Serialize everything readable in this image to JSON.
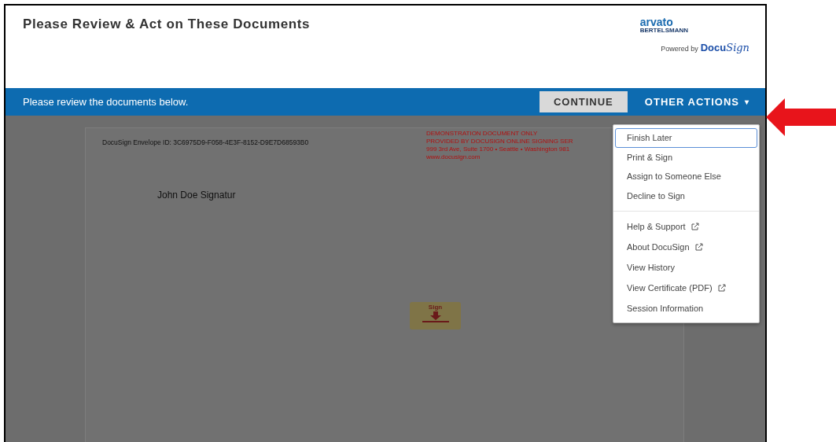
{
  "header": {
    "title": "Please Review & Act on These Documents",
    "brand": {
      "name": "arvato",
      "sub": "BERTELSMANN",
      "powered_by": "Powered by",
      "docu": "Docu",
      "sign": "Sign"
    }
  },
  "action_bar": {
    "message": "Please review the documents below.",
    "continue_button": "CONTINUE",
    "other_actions": "OTHER ACTIONS",
    "caret": "▾"
  },
  "document": {
    "envelope_id": "DocuSign Envelope ID: 3C6975D9-F058-4E3F-8152-D9E7D68593B0",
    "demo_notice": [
      "DEMONSTRATION DOCUMENT ONLY",
      "PROVIDED BY DOCUSIGN ONLINE SIGNING SER",
      "999 3rd Ave, Suite 1700  • Seattle • Washington 981",
      "www.docusign.com"
    ],
    "signature_label": "John Doe Signatur",
    "sign_tag": "Sign"
  },
  "menu": {
    "groups": [
      [
        {
          "label": "Finish Later",
          "focused": true,
          "external": false
        },
        {
          "label": "Print & Sign",
          "focused": false,
          "external": false
        },
        {
          "label": "Assign to Someone Else",
          "focused": false,
          "external": false
        },
        {
          "label": "Decline to Sign",
          "focused": false,
          "external": false
        }
      ],
      [
        {
          "label": "Help & Support",
          "focused": false,
          "external": true
        },
        {
          "label": "About DocuSign",
          "focused": false,
          "external": true
        },
        {
          "label": "View History",
          "focused": false,
          "external": false
        },
        {
          "label": "View Certificate (PDF)",
          "focused": false,
          "external": true
        },
        {
          "label": "Session Information",
          "focused": false,
          "external": false
        }
      ]
    ]
  }
}
